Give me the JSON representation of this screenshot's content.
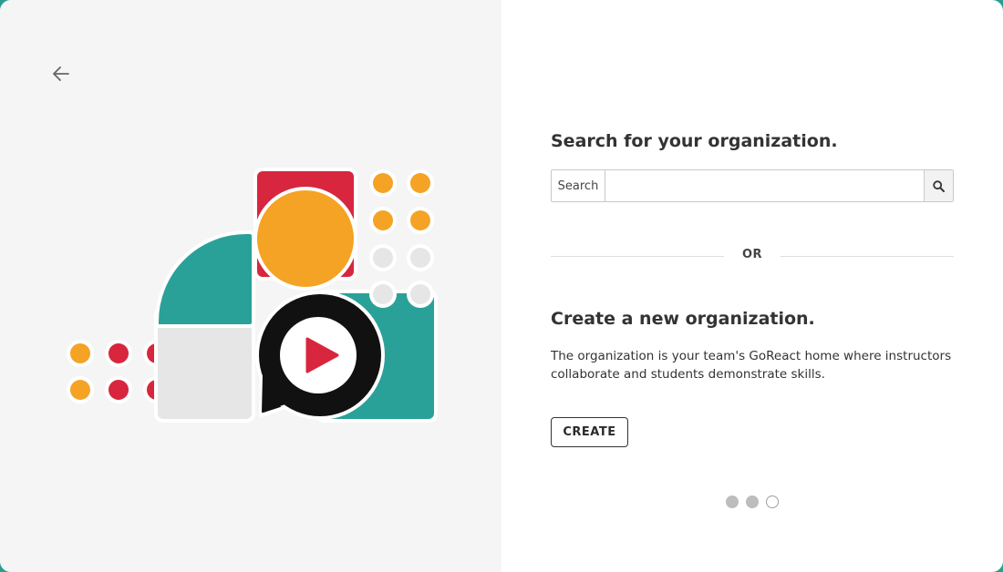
{
  "search_section": {
    "heading": "Search for your organization.",
    "label": "Search",
    "input_value": "",
    "input_placeholder": ""
  },
  "divider": {
    "text": "OR"
  },
  "create_section": {
    "heading": "Create a new organization.",
    "description": "The organization is your team's GoReact home where instructors collaborate and students demonstrate skills.",
    "button_label": "CREATE"
  },
  "pager": {
    "total": 3,
    "current": 3
  },
  "icons": {
    "back": "arrow-left-icon",
    "search": "magnifier-icon",
    "illustration": "goreact-play-illustration"
  },
  "colors": {
    "teal": "#2aa198",
    "orange": "#f4a325",
    "red": "#d7263d",
    "light_gray": "#e6e6e6",
    "black": "#111111",
    "left_panel_bg": "#f5f5f5"
  }
}
